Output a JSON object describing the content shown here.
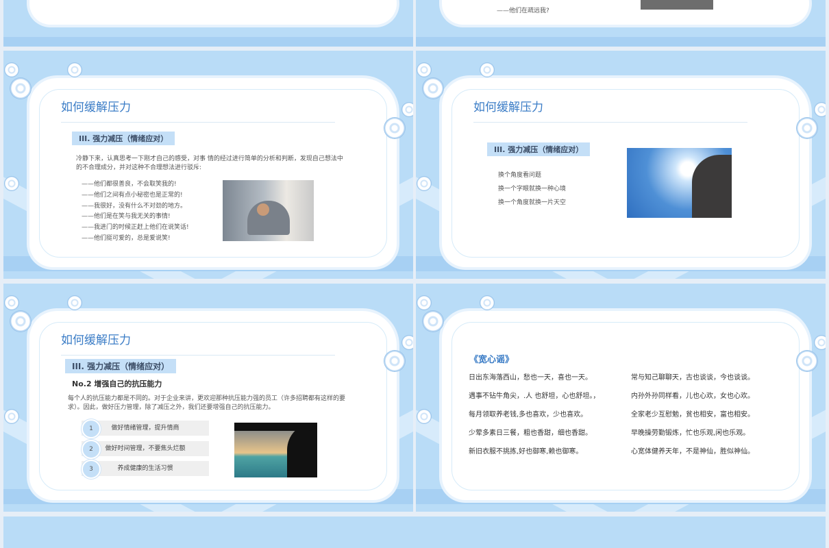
{
  "top_left": {},
  "top_right": {
    "line": "——他们在疏远我?"
  },
  "slide1": {
    "title": "如何缓解压力",
    "tag": "III. 强力减压（情绪应对）",
    "para": "冷静下来，认真思考一下刚才自己的感受，对事 情的经过进行简单的分析和判断，发现自己想法中的不合理成分，并对这种不合理想法进行驳斥:",
    "lines": [
      "——他们都很善良，不会取笑我的!",
      "——他们之间有点小秘密也是正常的!",
      "——我很好，没有什么不对劲的地方。",
      "——他们是在笑与我无关的事情!",
      "——我进门的时候正赶上他们在说笑话!",
      "——他们挺可爱的，总是爱说笑!"
    ]
  },
  "slide2": {
    "title": "如何缓解压力",
    "tag": "III. 强力减压（情绪应对）",
    "lines": [
      "换个角度看问题",
      "换一个字眼就换一种心境",
      "换一个角度就换一片天空"
    ]
  },
  "slide3": {
    "title": "如何缓解压力",
    "tag": "III. 强力减压（情绪应对）",
    "subtitle": "No.2  增强自己的抗压能力",
    "para": "每个人的抗压能力都是不同的。对于企业来讲，更欢迎那种抗压能力强的员工（许多招聘都有这样的要求）。因此，做好压力管理，除了减压之外，我们还要增强自己的抗压能力。",
    "items": [
      {
        "num": "1",
        "label": "做好情绪管理，提升情商"
      },
      {
        "num": "2",
        "label": "做好时间管理，不要焦头烂额"
      },
      {
        "num": "3",
        "label": "养成健康的生活习惯"
      }
    ]
  },
  "slide4": {
    "title": "《宽心谣》",
    "left": [
      "日出东海落西山，愁也一天，喜也一天。",
      "遇事不钻牛角尖，.人 也舒坦，心也舒坦。，",
      "每月领取养老钱,多也喜欢，少也喜欢。",
      "少荤多素日三餐，粗也香甜，细也香甜。",
      "新旧衣服不挑拣,好也御寒,赖也御寒。"
    ],
    "right": [
      "常与知己聊聊天，古也谈谈，今也谈谈。",
      "内孙外孙同样看，儿也心欢，女也心欢。",
      "全家老少互慰勉，贫也相安，富也相安。",
      "早晚操劳勤锻炼，忙也乐观,闲也乐观。",
      "心宽体健养天年，不是神仙，胜似神仙。"
    ]
  }
}
